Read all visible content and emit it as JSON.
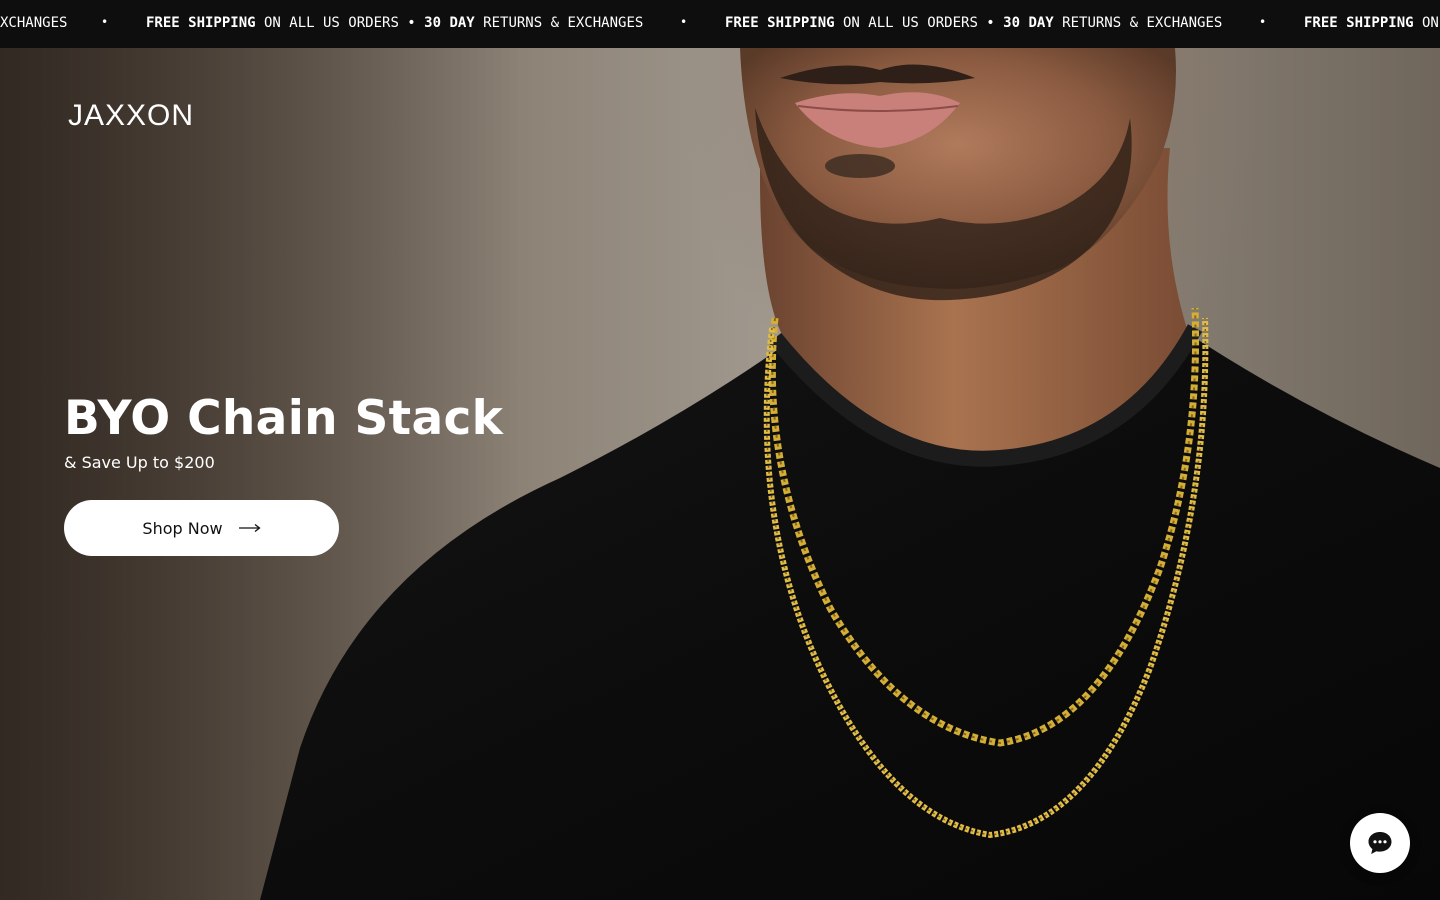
{
  "announcement": {
    "bold_1": "FREE SHIPPING",
    "text_1": " ON ALL US ORDERS • ",
    "bold_2": "30 DAY",
    "text_2": " RETURNS & EXCHANGES",
    "leading_fragment": "XCHANGES",
    "trailing_bold": "FREE SHIPPING",
    "trailing_text": " ON",
    "bullet": "•"
  },
  "brand": {
    "logo_text": "JAXXON"
  },
  "hero": {
    "title": "BYO Chain Stack",
    "subtitle": "& Save Up to $200",
    "cta_label": "Shop Now"
  },
  "icons": {
    "cta_arrow": "arrow-right-icon",
    "chat": "chat-bubble-icon"
  },
  "colors": {
    "announcement_bg": "#0e0e0e",
    "button_bg": "#ffffff",
    "gold": "#d4af37"
  }
}
